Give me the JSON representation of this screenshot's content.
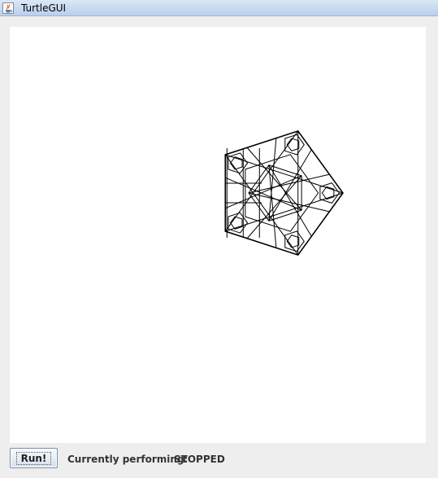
{
  "window": {
    "title": "TurtleGUI",
    "icon": "java-cup-icon"
  },
  "canvas": {
    "background": "#ffffff",
    "stroke_color": "#000000",
    "drawing": "pentagon-fractal"
  },
  "controls": {
    "run_label": "Run!",
    "status_label": "Currently performing:",
    "status_value": "STOPPED"
  }
}
